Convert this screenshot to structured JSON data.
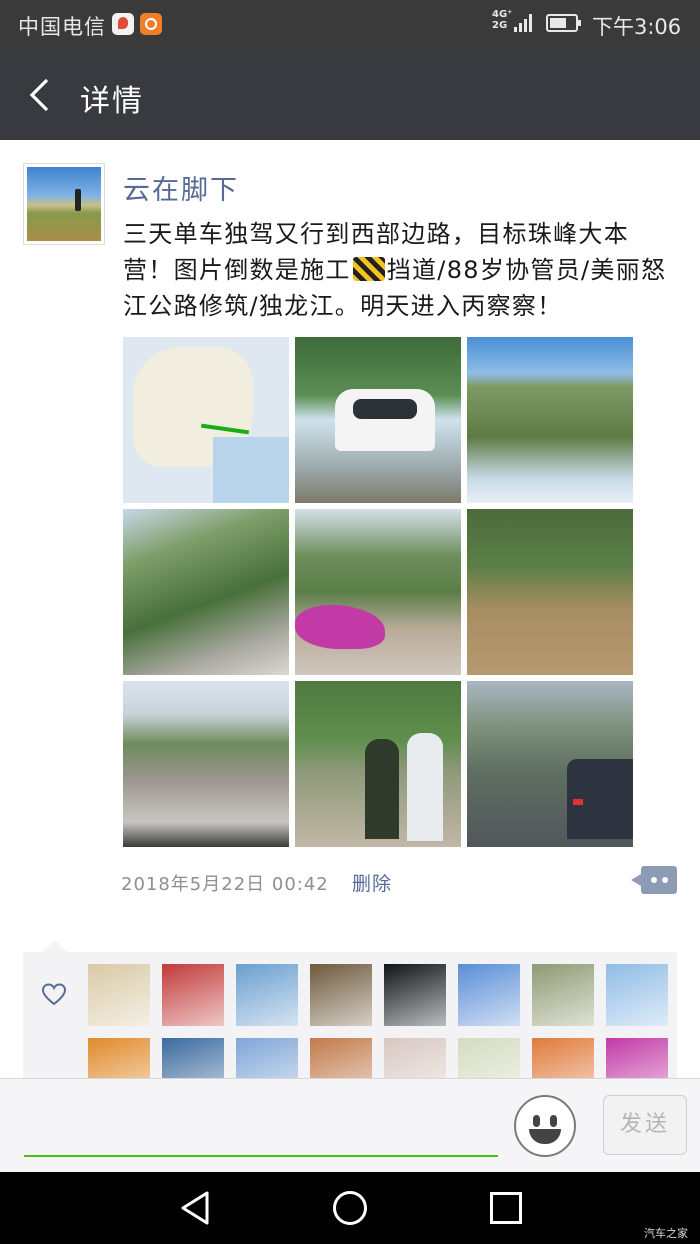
{
  "status_bar": {
    "carrier": "中国电信",
    "network": [
      "4G⁺",
      "2G"
    ],
    "time": "下午3:06"
  },
  "header": {
    "title": "详情",
    "back_icon": "chevron-left-icon"
  },
  "post": {
    "username": "云在脚下",
    "text_before_emoji": "三天单车独驾又行到西部边路，目标珠峰大本营！图片倒数是施工",
    "emoji": "construction-sign-emoji",
    "text_after_emoji": "挡道/88岁协管员/美丽怒江公路修筑/独龙江。明天进入丙察察！",
    "photos": [
      "map",
      "white-suv-splash",
      "mountain-switchback",
      "river-gorge",
      "flowers-riverside",
      "muddy-river",
      "road-rubble",
      "two-men-portrait",
      "excavator-roadwork"
    ],
    "timestamp": "2018年5月22日  00:42",
    "delete_label": "删除",
    "comment_icon": "comment-dots-icon"
  },
  "likes": {
    "heart_icon": "heart-outline-icon",
    "avatar_colors": [
      "#d9c9a5",
      "#c23a3a",
      "#6a9fd0",
      "#6e5a3c",
      "#101418",
      "#5a8ed6",
      "#8e9a72",
      "#8fbce6",
      "#e08a2a",
      "#3a6a9e",
      "#7fa6d8",
      "#c27a4a",
      "#d8c8c2",
      "#d4dbc0",
      "#e07a3a",
      "#c23aa6"
    ]
  },
  "input_bar": {
    "placeholder": "",
    "emoji_icon": "smiley-icon",
    "send_label": "发送"
  },
  "nav_bar": {
    "back_icon": "triangle-back-icon",
    "home_icon": "circle-home-icon",
    "recent_icon": "square-recents-icon"
  },
  "watermark": "汽车之家"
}
